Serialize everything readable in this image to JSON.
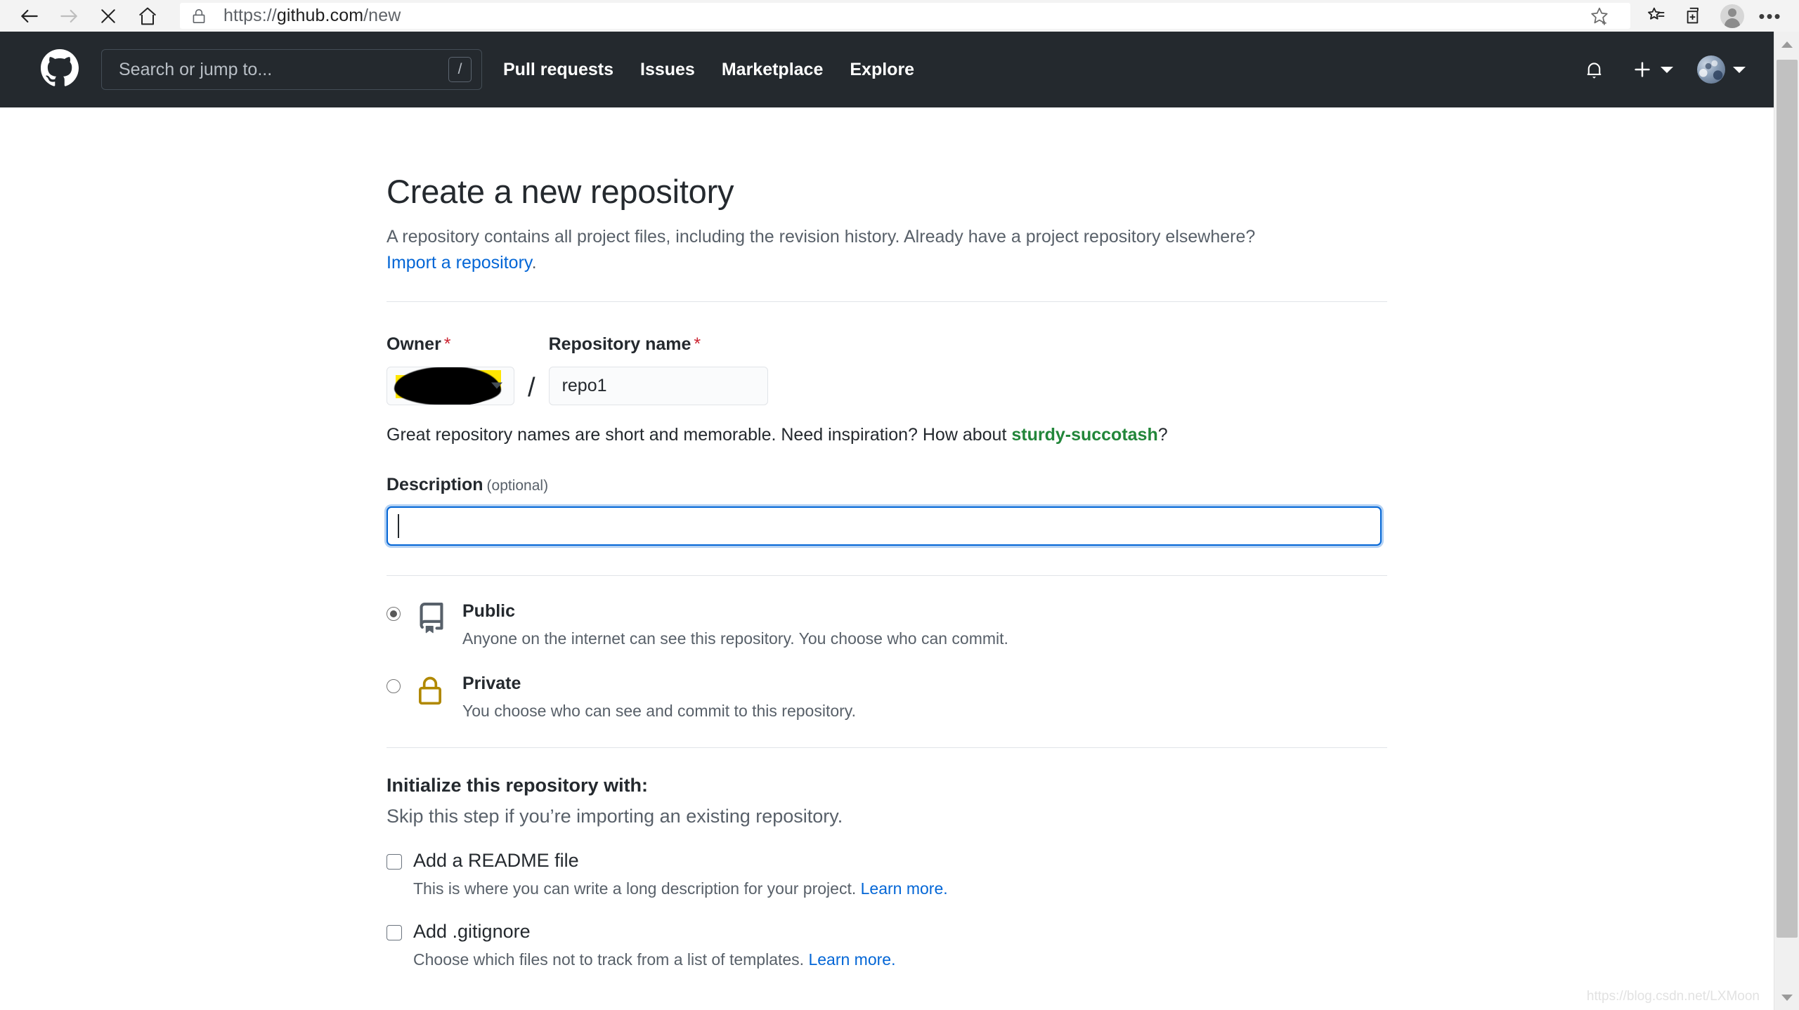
{
  "browser": {
    "url_scheme": "https://",
    "url_host": "github.com",
    "url_path": "/new",
    "back_icon": "back-arrow-icon",
    "forward_icon": "forward-arrow-icon",
    "stop_icon": "stop-x-icon",
    "home_icon": "home-icon",
    "lock_icon": "lock-icon",
    "favorite_icon": "star-add-icon",
    "collections_icon": "favorites-list-icon",
    "tabs_icon": "add-collection-icon",
    "profile_icon": "profile-avatar-icon",
    "settings_icon": "more-options-icon",
    "more_label": "•••"
  },
  "gh_header": {
    "logo": "github-mark-icon",
    "search_placeholder": "Search or jump to...",
    "search_shortcut": "/",
    "nav": [
      {
        "label": "Pull requests"
      },
      {
        "label": "Issues"
      },
      {
        "label": "Marketplace"
      },
      {
        "label": "Explore"
      }
    ],
    "notifications_icon": "bell-icon",
    "create_new_icon": "plus-icon",
    "avatar": "user-avatar"
  },
  "page": {
    "title": "Create a new repository",
    "subtitle": "A repository contains all project files, including the revision history. Already have a project repository elsewhere?",
    "import_link": "Import a repository",
    "import_link_suffix": "."
  },
  "owner_field": {
    "label": "Owner",
    "required_mark": "*",
    "value": "",
    "redacted": true,
    "caret_icon": "chevron-down-icon"
  },
  "repo_field": {
    "label": "Repository name",
    "required_mark": "*",
    "value": "repo1",
    "separator": "/"
  },
  "name_hint": {
    "before": "Great repository names are short and memorable. Need inspiration? How about ",
    "suggestion": "sturdy-succotash",
    "after": "?"
  },
  "description_field": {
    "label": "Description",
    "optional": "(optional)",
    "value": "",
    "placeholder": "",
    "focused": true
  },
  "visibility": [
    {
      "id": "public",
      "title": "Public",
      "description": "Anyone on the internet can see this repository. You choose who can commit.",
      "icon": "repo-book-icon",
      "selected": true
    },
    {
      "id": "private",
      "title": "Private",
      "description": "You choose who can see and commit to this repository.",
      "icon": "lock-icon",
      "selected": false
    }
  ],
  "initialize": {
    "title": "Initialize this repository with:",
    "subtitle": "Skip this step if you’re importing an existing repository.",
    "options": [
      {
        "label": "Add a README file",
        "description": "This is where you can write a long description for your project.",
        "learn_more": "Learn more.",
        "checked": false
      },
      {
        "label": "Add .gitignore",
        "description": "Choose which files not to track from a list of templates.",
        "learn_more": "Learn more.",
        "checked": false
      }
    ]
  },
  "watermark": "https://blog.csdn.net/LXMoon",
  "colors": {
    "gh_header_bg": "#24292e",
    "accent_link": "#0366d6",
    "suggest_green": "#22863a",
    "required_red": "#cb2431",
    "private_gold": "#b08800",
    "highlight_yellow": "#ffe600"
  }
}
